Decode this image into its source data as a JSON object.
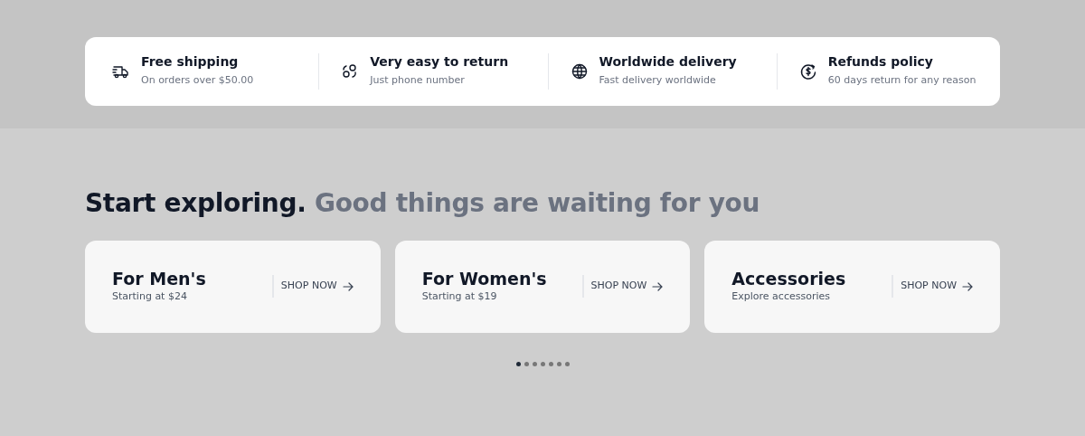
{
  "features": [
    {
      "title": "Free shipping",
      "subtitle": "On orders over $50.00"
    },
    {
      "title": "Very easy to return",
      "subtitle": "Just phone number"
    },
    {
      "title": "Worldwide delivery",
      "subtitle": "Fast delivery worldwide"
    },
    {
      "title": "Refunds policy",
      "subtitle": "60 days return for any reason"
    }
  ],
  "heading": {
    "lead": "Start exploring.",
    "rest": "Good things are waiting for you"
  },
  "categories": [
    {
      "title": "For Men's",
      "subtitle": "Starting at $24",
      "link": "SHOP NOW"
    },
    {
      "title": "For Women's",
      "subtitle": "Starting at $19",
      "link": "SHOP NOW"
    },
    {
      "title": "Accessories",
      "subtitle": "Explore accessories",
      "link": "SHOP NOW"
    }
  ],
  "pager": [
    {
      "selected": true
    },
    {
      "selected": false
    },
    {
      "selected": false
    },
    {
      "selected": false
    },
    {
      "selected": false
    },
    {
      "selected": false
    },
    {
      "selected": false
    }
  ]
}
